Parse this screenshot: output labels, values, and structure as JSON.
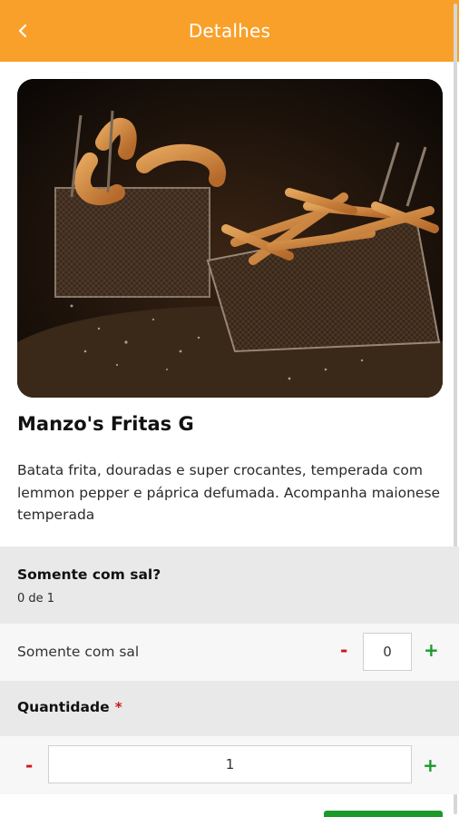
{
  "header": {
    "title": "Detalhes",
    "back_icon": "chevron-left-icon",
    "background": "#f9a02a"
  },
  "product": {
    "name": "Manzo's Fritas G",
    "description": "Batata frita, douradas e super crocantes, temperada com lemmon pepper e páprica defumada. Acompanha maionese temperada"
  },
  "options_group": {
    "title": "Somente com sal?",
    "selected_count": "0 de 1",
    "items": [
      {
        "label": "Somente com sal",
        "value": "0",
        "minus": "-",
        "plus": "+"
      }
    ]
  },
  "quantity": {
    "title": "Quantidade",
    "required_mark": "*",
    "value": "1",
    "minus": "-",
    "plus": "+"
  },
  "colors": {
    "accent": "#f9a02a",
    "decrement": "#cc1a1a",
    "increment": "#1a9a2a"
  }
}
